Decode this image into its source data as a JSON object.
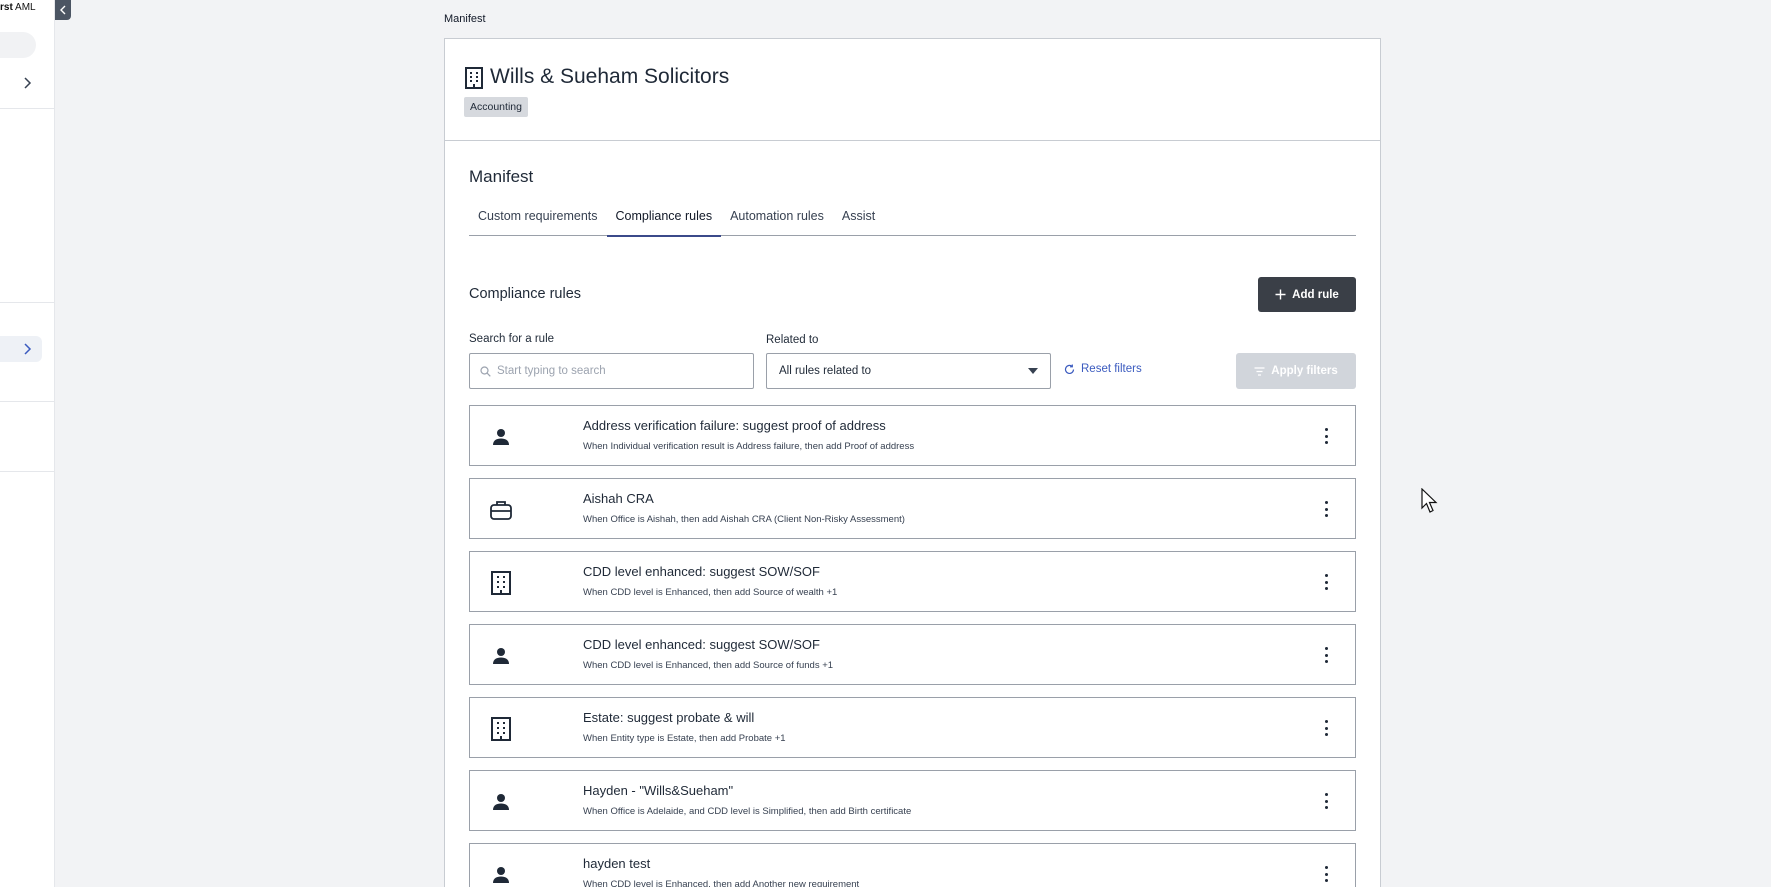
{
  "sidebar": {
    "brand_bold": "rst",
    "brand_rest": " AML"
  },
  "breadcrumb": "Manifest",
  "org": {
    "name": "Wills & Sueham Solicitors",
    "badge": "Accounting"
  },
  "section_title": "Manifest",
  "tabs": [
    {
      "label": "Custom requirements",
      "active": false
    },
    {
      "label": "Compliance rules",
      "active": true
    },
    {
      "label": "Automation rules",
      "active": false
    },
    {
      "label": "Assist",
      "active": false
    }
  ],
  "rules_section": {
    "title": "Compliance rules",
    "add_label": "Add rule",
    "search_label": "Search for a rule",
    "search_placeholder": "Start typing to search",
    "related_label": "Related to",
    "related_value": "All rules related to",
    "reset_label": "Reset filters",
    "apply_label": "Apply filters"
  },
  "rules": [
    {
      "icon": "person-icon",
      "title": "Address verification failure: suggest proof of address",
      "description": "When Individual verification result is Address failure, then add Proof of address"
    },
    {
      "icon": "briefcase-icon",
      "title": "Aishah CRA",
      "description": "When Office is Aishah, then add Aishah CRA (Client Non-Risky Assessment)"
    },
    {
      "icon": "building-icon",
      "title": "CDD level enhanced: suggest SOW/SOF",
      "description": "When CDD level is Enhanced, then add Source of wealth +1"
    },
    {
      "icon": "person-icon",
      "title": "CDD level enhanced: suggest SOW/SOF",
      "description": "When CDD level is Enhanced, then add Source of funds +1"
    },
    {
      "icon": "building-icon",
      "title": "Estate: suggest probate & will",
      "description": "When Entity type is Estate, then add Probate +1"
    },
    {
      "icon": "person-icon",
      "title": "Hayden - \"Wills&Sueham\"",
      "description": "When Office is Adelaide, and CDD level is Simplified, then add Birth certificate"
    },
    {
      "icon": "person-icon",
      "title": "hayden test",
      "description": "When CDD level is Enhanced, then add Another new requirement"
    }
  ]
}
